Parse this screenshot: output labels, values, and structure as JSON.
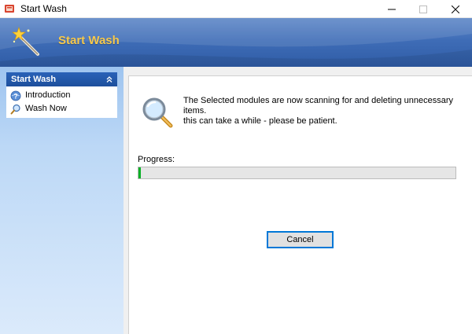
{
  "window": {
    "title": "Start Wash",
    "controls": [
      "minimize-icon",
      "maximize-icon",
      "close-icon"
    ]
  },
  "banner": {
    "title": "Start Wash",
    "icon": "magic-wand-icon",
    "title_color": "#f7c94b"
  },
  "sidebar": {
    "panel_title": "Start Wash",
    "collapse_icon": "double-chevron-up-icon",
    "items": [
      {
        "label": "Introduction",
        "icon": "help-globe-icon"
      },
      {
        "label": "Wash Now",
        "icon": "magnifier-icon"
      }
    ]
  },
  "main": {
    "icon": "magnifier-icon",
    "message_line1": "The Selected modules are now scanning for and deleting unnecessary items.",
    "message_line2": "this can take a while - please be patient.",
    "progress_label": "Progress:",
    "progress_fraction": 0.006,
    "progress_color": "#06b025",
    "cancel_label": "Cancel"
  }
}
